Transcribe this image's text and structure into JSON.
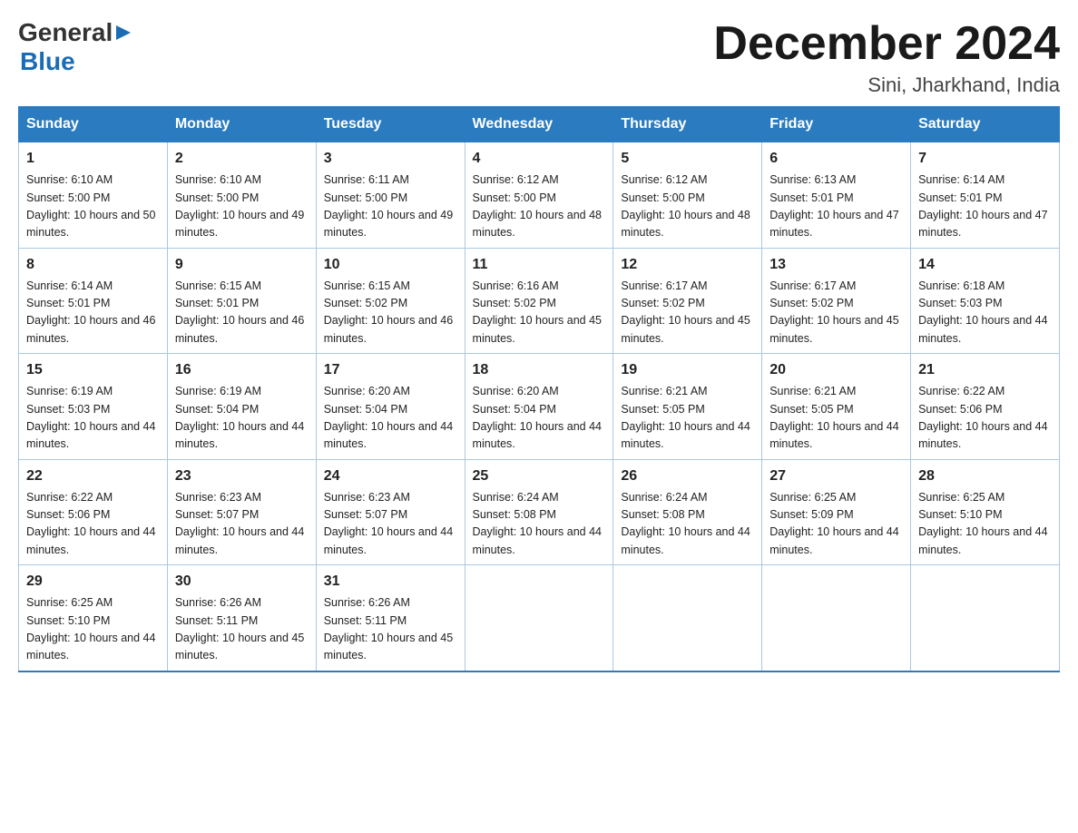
{
  "header": {
    "logo_general": "General",
    "logo_blue": "Blue",
    "title": "December 2024",
    "location": "Sini, Jharkhand, India"
  },
  "weekdays": [
    "Sunday",
    "Monday",
    "Tuesday",
    "Wednesday",
    "Thursday",
    "Friday",
    "Saturday"
  ],
  "weeks": [
    [
      {
        "day": "1",
        "sunrise": "6:10 AM",
        "sunset": "5:00 PM",
        "daylight": "10 hours and 50 minutes."
      },
      {
        "day": "2",
        "sunrise": "6:10 AM",
        "sunset": "5:00 PM",
        "daylight": "10 hours and 49 minutes."
      },
      {
        "day": "3",
        "sunrise": "6:11 AM",
        "sunset": "5:00 PM",
        "daylight": "10 hours and 49 minutes."
      },
      {
        "day": "4",
        "sunrise": "6:12 AM",
        "sunset": "5:00 PM",
        "daylight": "10 hours and 48 minutes."
      },
      {
        "day": "5",
        "sunrise": "6:12 AM",
        "sunset": "5:00 PM",
        "daylight": "10 hours and 48 minutes."
      },
      {
        "day": "6",
        "sunrise": "6:13 AM",
        "sunset": "5:01 PM",
        "daylight": "10 hours and 47 minutes."
      },
      {
        "day": "7",
        "sunrise": "6:14 AM",
        "sunset": "5:01 PM",
        "daylight": "10 hours and 47 minutes."
      }
    ],
    [
      {
        "day": "8",
        "sunrise": "6:14 AM",
        "sunset": "5:01 PM",
        "daylight": "10 hours and 46 minutes."
      },
      {
        "day": "9",
        "sunrise": "6:15 AM",
        "sunset": "5:01 PM",
        "daylight": "10 hours and 46 minutes."
      },
      {
        "day": "10",
        "sunrise": "6:15 AM",
        "sunset": "5:02 PM",
        "daylight": "10 hours and 46 minutes."
      },
      {
        "day": "11",
        "sunrise": "6:16 AM",
        "sunset": "5:02 PM",
        "daylight": "10 hours and 45 minutes."
      },
      {
        "day": "12",
        "sunrise": "6:17 AM",
        "sunset": "5:02 PM",
        "daylight": "10 hours and 45 minutes."
      },
      {
        "day": "13",
        "sunrise": "6:17 AM",
        "sunset": "5:02 PM",
        "daylight": "10 hours and 45 minutes."
      },
      {
        "day": "14",
        "sunrise": "6:18 AM",
        "sunset": "5:03 PM",
        "daylight": "10 hours and 44 minutes."
      }
    ],
    [
      {
        "day": "15",
        "sunrise": "6:19 AM",
        "sunset": "5:03 PM",
        "daylight": "10 hours and 44 minutes."
      },
      {
        "day": "16",
        "sunrise": "6:19 AM",
        "sunset": "5:04 PM",
        "daylight": "10 hours and 44 minutes."
      },
      {
        "day": "17",
        "sunrise": "6:20 AM",
        "sunset": "5:04 PM",
        "daylight": "10 hours and 44 minutes."
      },
      {
        "day": "18",
        "sunrise": "6:20 AM",
        "sunset": "5:04 PM",
        "daylight": "10 hours and 44 minutes."
      },
      {
        "day": "19",
        "sunrise": "6:21 AM",
        "sunset": "5:05 PM",
        "daylight": "10 hours and 44 minutes."
      },
      {
        "day": "20",
        "sunrise": "6:21 AM",
        "sunset": "5:05 PM",
        "daylight": "10 hours and 44 minutes."
      },
      {
        "day": "21",
        "sunrise": "6:22 AM",
        "sunset": "5:06 PM",
        "daylight": "10 hours and 44 minutes."
      }
    ],
    [
      {
        "day": "22",
        "sunrise": "6:22 AM",
        "sunset": "5:06 PM",
        "daylight": "10 hours and 44 minutes."
      },
      {
        "day": "23",
        "sunrise": "6:23 AM",
        "sunset": "5:07 PM",
        "daylight": "10 hours and 44 minutes."
      },
      {
        "day": "24",
        "sunrise": "6:23 AM",
        "sunset": "5:07 PM",
        "daylight": "10 hours and 44 minutes."
      },
      {
        "day": "25",
        "sunrise": "6:24 AM",
        "sunset": "5:08 PM",
        "daylight": "10 hours and 44 minutes."
      },
      {
        "day": "26",
        "sunrise": "6:24 AM",
        "sunset": "5:08 PM",
        "daylight": "10 hours and 44 minutes."
      },
      {
        "day": "27",
        "sunrise": "6:25 AM",
        "sunset": "5:09 PM",
        "daylight": "10 hours and 44 minutes."
      },
      {
        "day": "28",
        "sunrise": "6:25 AM",
        "sunset": "5:10 PM",
        "daylight": "10 hours and 44 minutes."
      }
    ],
    [
      {
        "day": "29",
        "sunrise": "6:25 AM",
        "sunset": "5:10 PM",
        "daylight": "10 hours and 44 minutes."
      },
      {
        "day": "30",
        "sunrise": "6:26 AM",
        "sunset": "5:11 PM",
        "daylight": "10 hours and 45 minutes."
      },
      {
        "day": "31",
        "sunrise": "6:26 AM",
        "sunset": "5:11 PM",
        "daylight": "10 hours and 45 minutes."
      },
      null,
      null,
      null,
      null
    ]
  ]
}
